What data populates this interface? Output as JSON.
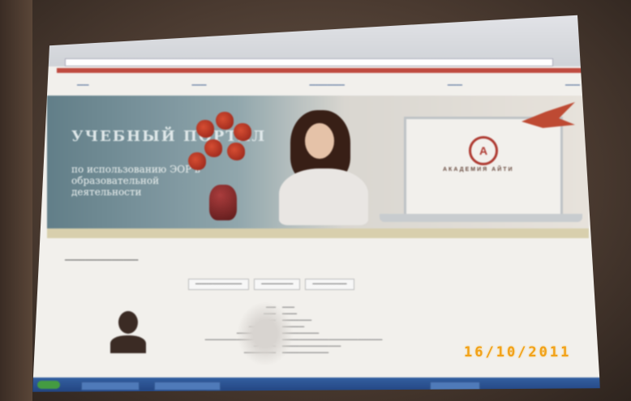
{
  "photo": {
    "subject": "projected-web-page",
    "banner": {
      "title": "УЧЕБНЫЙ ПОРТАЛ",
      "subtitle": "по использованию ЭОР в образовательной деятельности",
      "logo_letter": "А",
      "logo_text": "АКАДЕМИЯ АЙТИ"
    },
    "date_stamp": "16/10/2011"
  }
}
